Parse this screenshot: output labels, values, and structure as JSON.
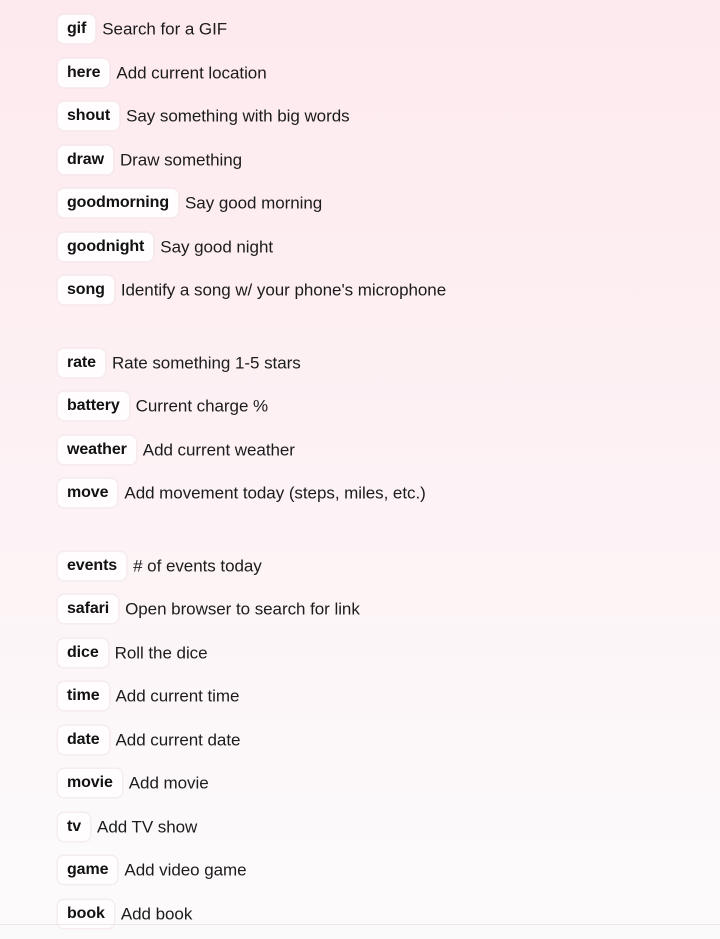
{
  "page": {
    "type": "keyword-shortcut-reference-list",
    "background_top_color": "#fdeaef",
    "background_bottom_color": "#fcfafb",
    "tag_background_color": "#fffdfe",
    "tag_text_color": "#111111",
    "description_text_color": "#1c1c1c"
  },
  "shortcuts": [
    {
      "keyword": "gif",
      "description": "Search for a GIF"
    },
    {
      "keyword": "here",
      "description": "Add current location"
    },
    {
      "keyword": "shout",
      "description": "Say something with big words"
    },
    {
      "keyword": "draw",
      "description": "Draw something"
    },
    {
      "keyword": "goodmorning",
      "description": "Say good morning"
    },
    {
      "keyword": "goodnight",
      "description": "Say good night"
    },
    {
      "keyword": "song",
      "description": "Identify a song w/ your phone's microphone"
    },
    {
      "keyword": "rate",
      "description": "Rate something 1-5 stars"
    },
    {
      "keyword": "battery",
      "description": "Current charge %"
    },
    {
      "keyword": "weather",
      "description": "Add current weather"
    },
    {
      "keyword": "move",
      "description": "Add movement today (steps, miles, etc.)"
    },
    {
      "keyword": "events",
      "description": "# of events today"
    },
    {
      "keyword": "safari",
      "description": "Open browser to search for link"
    },
    {
      "keyword": "dice",
      "description": "Roll the dice"
    },
    {
      "keyword": "time",
      "description": "Add current time"
    },
    {
      "keyword": "date",
      "description": "Add current date"
    },
    {
      "keyword": "movie",
      "description": "Add movie"
    },
    {
      "keyword": "tv",
      "description": "Add TV show"
    },
    {
      "keyword": "game",
      "description": "Add video game"
    },
    {
      "keyword": "book",
      "description": "Add book"
    }
  ]
}
